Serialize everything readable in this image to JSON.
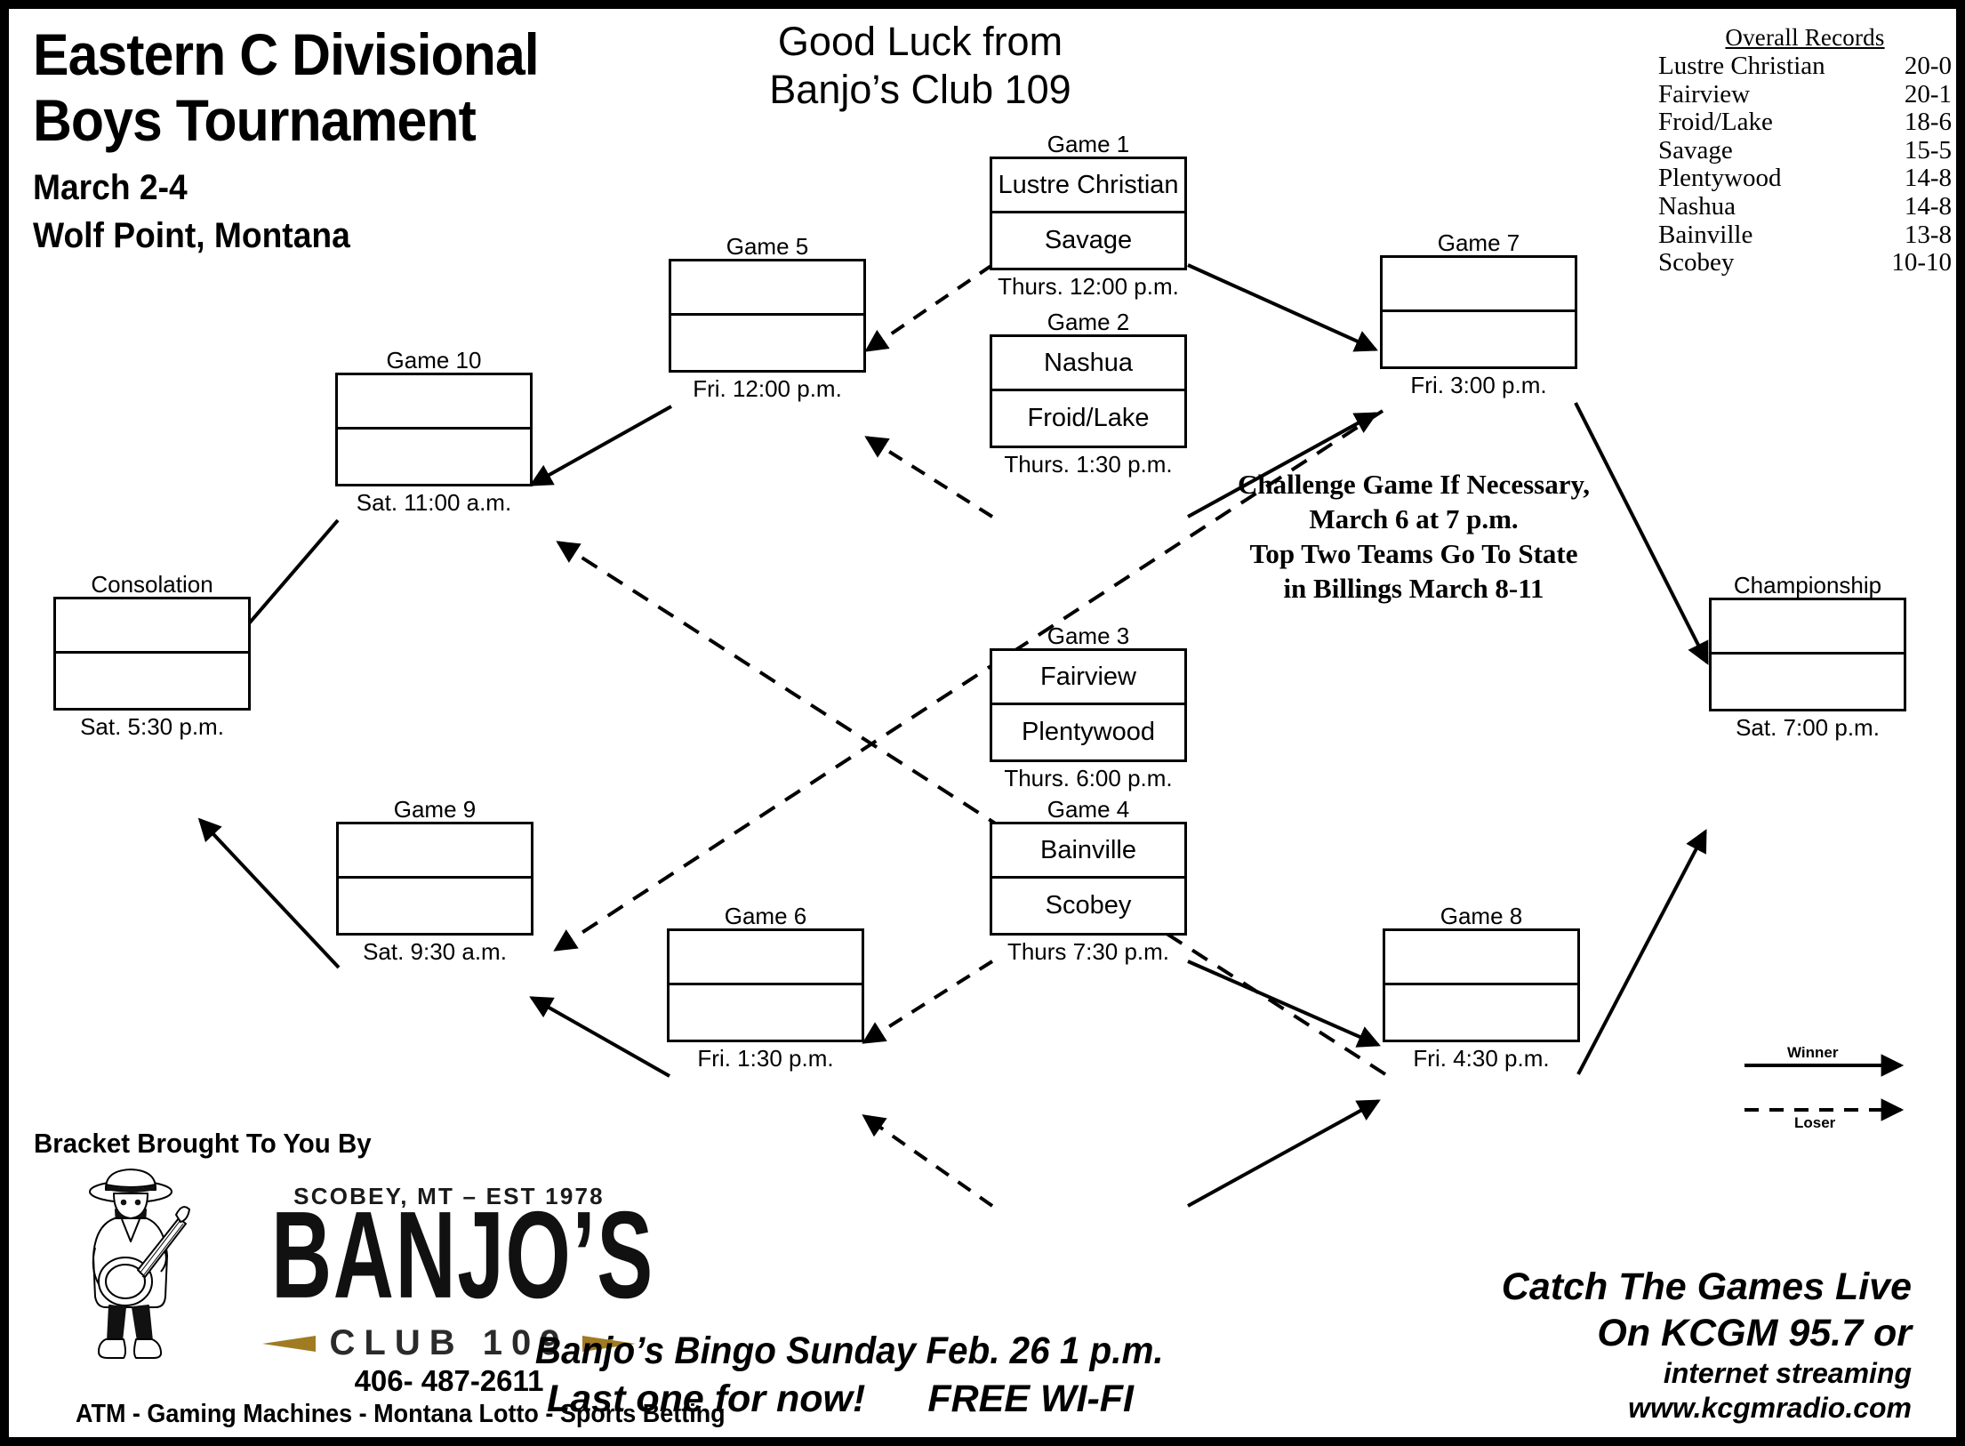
{
  "header": {
    "title_line1": "Eastern C Divisional",
    "title_line2": "Boys Tournament",
    "dates": "March 2-4",
    "location": "Wolf Point, Montana",
    "good_luck_line1": "Good Luck from",
    "good_luck_line2": "Banjo’s Club 109"
  },
  "records": {
    "heading": "Overall Records",
    "rows": [
      {
        "team": "Lustre Christian",
        "record": "20-0"
      },
      {
        "team": "Fairview",
        "record": "20-1"
      },
      {
        "team": "Froid/Lake",
        "record": "18-6"
      },
      {
        "team": "Savage",
        "record": "15-5"
      },
      {
        "team": "Plentywood",
        "record": "14-8"
      },
      {
        "team": "Nashua",
        "record": "14-8"
      },
      {
        "team": "Bainville",
        "record": "13-8"
      },
      {
        "team": "Scobey",
        "record": "10-10"
      }
    ]
  },
  "bracket": {
    "games": [
      {
        "label": "Game 1",
        "top": "Lustre Christian",
        "bottom": "Savage",
        "time": "Thurs. 12:00 p.m."
      },
      {
        "label": "Game 2",
        "top": "Nashua",
        "bottom": "Froid/Lake",
        "time": "Thurs. 1:30 p.m."
      },
      {
        "label": "Game 3",
        "top": "Fairview",
        "bottom": "Plentywood",
        "time": "Thurs. 6:00 p.m."
      },
      {
        "label": "Game 4",
        "top": "Bainville",
        "bottom": "Scobey",
        "time": "Thurs  7:30 p.m."
      },
      {
        "label": "Game 5",
        "top": "",
        "bottom": "",
        "time": "Fri. 12:00 p.m."
      },
      {
        "label": "Game 6",
        "top": "",
        "bottom": "",
        "time": "Fri. 1:30 p.m."
      },
      {
        "label": "Game 7",
        "top": "",
        "bottom": "",
        "time": "Fri. 3:00 p.m."
      },
      {
        "label": "Game 8",
        "top": "",
        "bottom": "",
        "time": "Fri. 4:30 p.m."
      },
      {
        "label": "Game 9",
        "top": "",
        "bottom": "",
        "time": "Sat. 9:30 a.m."
      },
      {
        "label": "Game 10",
        "top": "",
        "bottom": "",
        "time": "Sat. 11:00 a.m."
      },
      {
        "label": "Consolation",
        "top": "",
        "bottom": "",
        "time": "Sat. 5:30 p.m."
      },
      {
        "label": "Championship",
        "top": "",
        "bottom": "",
        "time": "Sat. 7:00 p.m."
      }
    ]
  },
  "challenge": {
    "line1": "Challenge Game If Necessary,",
    "line2": "March 6  at 7 p.m.",
    "line3": "Top Two Teams Go To State",
    "line4": "in Billings March 8-11"
  },
  "legend": {
    "winner": "Winner",
    "loser": "Loser"
  },
  "sponsor": {
    "bracket_by": "Bracket Brought To You By",
    "logo_est": "SCOBEY, MT – EST 1978",
    "logo_name": "BANJO’S",
    "logo_club": "CLUB 109",
    "phone": "406- 487-2611",
    "amenities": "ATM - Gaming Machines - Montana Lotto -  Sports Betting",
    "accent_color": "#a07b22"
  },
  "promo": {
    "bingo_line1": "Banjo’s Bingo Sunday Feb. 26 1 p.m.",
    "bingo_line2": "Last one for now!",
    "bingo_line3": "FREE WI-FI"
  },
  "radio": {
    "line1": "Catch The Games Live",
    "line2": "On KCGM 95.7 or",
    "line3": "internet streaming",
    "line4": "www.kcgmradio.com"
  }
}
